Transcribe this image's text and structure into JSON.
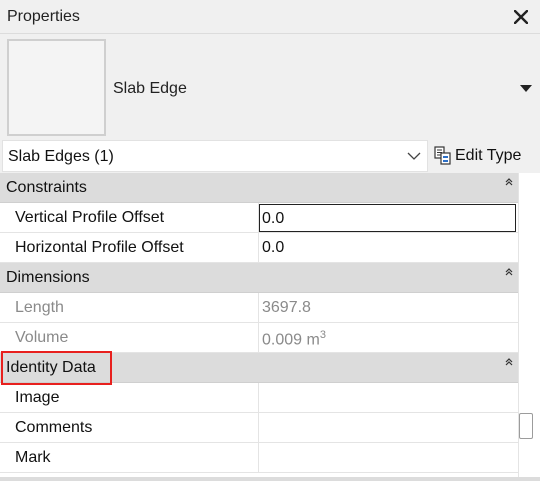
{
  "panel": {
    "title": "Properties",
    "close_icon": "close-icon"
  },
  "type_selector": {
    "type_name": "Slab Edge",
    "dropdown_icon": "caret-down-icon"
  },
  "filter": {
    "selection_label": "Slab Edges (1)",
    "chevron_icon": "chevron-down-icon",
    "edit_type_label": "Edit Type",
    "edit_type_icon": "edit-type-icon"
  },
  "groups": [
    {
      "title": "Constraints",
      "properties": [
        {
          "name": "Vertical Profile Offset",
          "value": "0.0"
        },
        {
          "name": "Horizontal Profile Offset",
          "value": "0.0"
        }
      ]
    },
    {
      "title": "Dimensions",
      "properties": [
        {
          "name": "Length",
          "value": "3697.8"
        },
        {
          "name": "Volume",
          "value": "0.009 m",
          "unit_power": "3"
        }
      ]
    },
    {
      "title": "Identity Data",
      "properties": [
        {
          "name": "Image",
          "value": ""
        },
        {
          "name": "Comments",
          "value": ""
        },
        {
          "name": "Mark",
          "value": ""
        }
      ]
    }
  ],
  "colors": {
    "highlight": "#e8201e",
    "group_header_bg": "#dcdcdc",
    "readonly_text": "#8a8a8a"
  }
}
